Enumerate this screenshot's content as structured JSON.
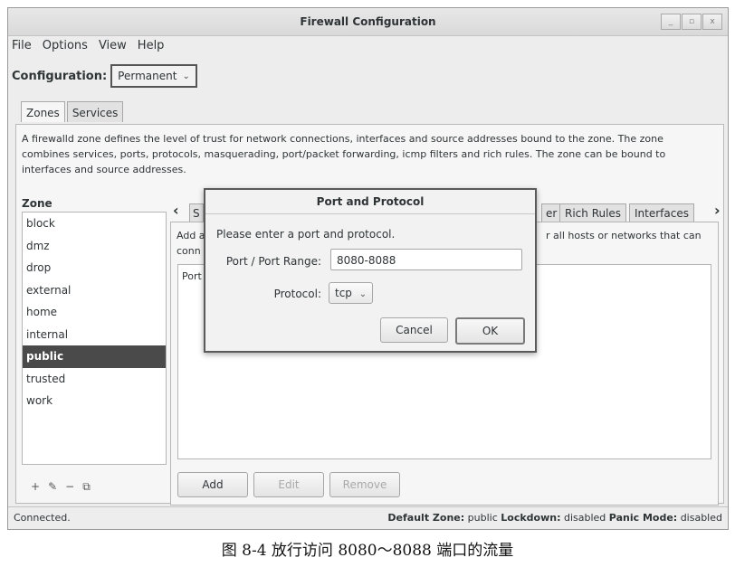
{
  "window": {
    "title": "Firewall Configuration",
    "controls": [
      "_",
      "▫",
      "x"
    ]
  },
  "menu": [
    "File",
    "Options",
    "View",
    "Help"
  ],
  "configuration": {
    "label": "Configuration:",
    "value": "Permanent"
  },
  "tabs": [
    "Zones",
    "Services"
  ],
  "description": "A firewalld zone defines the level of trust for network connections, interfaces and source addresses bound to the zone. The zone combines services, ports, protocols, masquerading, port/packet forwarding, icmp filters and rich rules. The zone can be bound to interfaces and source addresses.",
  "zones": {
    "header": "Zone",
    "items": [
      "block",
      "dmz",
      "drop",
      "external",
      "home",
      "internal",
      "public",
      "trusted",
      "work"
    ],
    "selected": "public",
    "tools": [
      "+",
      "✎",
      "−",
      "⧉"
    ]
  },
  "zone_tabs": {
    "left_partial": "S",
    "right_partial": "er",
    "visible": [
      "Rich Rules",
      "Interfaces"
    ]
  },
  "subpanel": {
    "text_left_line1": "Add a",
    "text_left_line2": "conn",
    "text_right": "r all hosts or networks that can",
    "column_header": "Port"
  },
  "buttons": {
    "add": "Add",
    "edit": "Edit",
    "remove": "Remove"
  },
  "dialog": {
    "title": "Port and Protocol",
    "prompt": "Please enter a port and protocol.",
    "range_label": "Port / Port Range:",
    "range_value": "8080-8088",
    "protocol_label": "Protocol:",
    "protocol_value": "tcp",
    "cancel": "Cancel",
    "ok": "OK"
  },
  "status": {
    "left": "Connected.",
    "default_zone_label": "Default Zone:",
    "default_zone": "public",
    "lockdown_label": "Lockdown:",
    "lockdown": "disabled",
    "panic_label": "Panic Mode:",
    "panic": "disabled"
  },
  "caption": "图 8-4   放行访问 8080～8088 端口的流量"
}
